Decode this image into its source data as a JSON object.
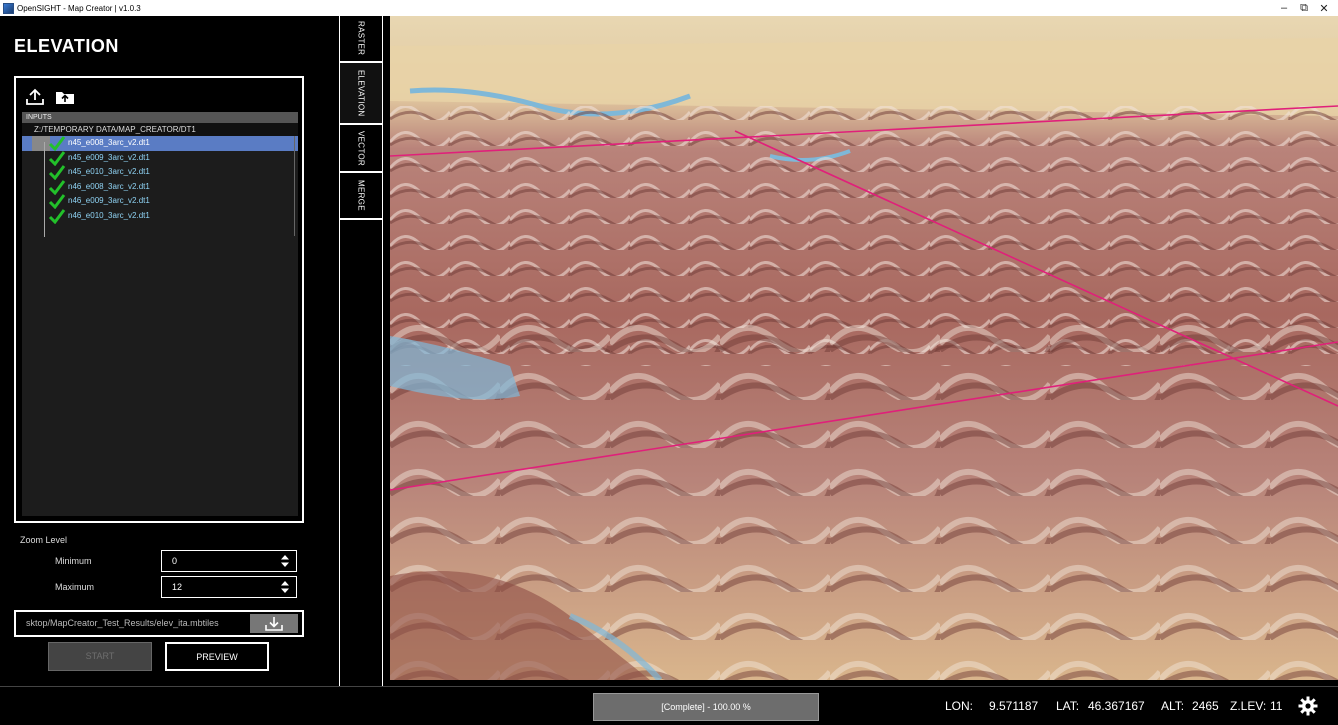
{
  "window": {
    "title": "OpenSIGHT - Map Creator | v1.0.3",
    "minimize": "–",
    "maximize": "⧉",
    "close": "✕"
  },
  "panel": {
    "title": "ELEVATION",
    "toolbar": {
      "upload_icon": "upload-icon",
      "folder_upload_icon": "folder-upload-icon"
    },
    "tree": {
      "header": "INPUTS",
      "root": "Z:/TEMPORARY DATA/MAP_CREATOR/DT1",
      "items": [
        {
          "label": "n45_e008_3arc_v2.dt1",
          "selected": true,
          "checked": true
        },
        {
          "label": "n45_e009_3arc_v2.dt1",
          "selected": false,
          "checked": true
        },
        {
          "label": "n45_e010_3arc_v2.dt1",
          "selected": false,
          "checked": true
        },
        {
          "label": "n46_e008_3arc_v2.dt1",
          "selected": false,
          "checked": true
        },
        {
          "label": "n46_e009_3arc_v2.dt1",
          "selected": false,
          "checked": true
        },
        {
          "label": "n46_e010_3arc_v2.dt1",
          "selected": false,
          "checked": true
        }
      ]
    },
    "zoom": {
      "label": "Zoom Level",
      "min_label": "Minimum",
      "min_value": "0",
      "max_label": "Maximum",
      "max_value": "12"
    },
    "output_path": "sktop/MapCreator_Test_Results/elev_ita.mbtiles",
    "start_label": "START",
    "preview_label": "PREVIEW"
  },
  "tabs": [
    "RASTER",
    "ELEVATION",
    "VECTOR",
    "MERGE"
  ],
  "status": {
    "progress_text": "[Complete] - 100.00 %",
    "progress_fraction": 1.0,
    "lon_label": "LON:",
    "lon": "9.571187",
    "lat_label": "LAT:",
    "lat": "46.367167",
    "alt_label": "ALT:",
    "alt": "2465",
    "zlev_label": "Z.LEV:",
    "zlev": "11"
  },
  "colors": {
    "accent_selected": "#5a7cc4",
    "check": "#22c02a",
    "grid_line": "#e0207a",
    "terrain_high": "#9c5a55",
    "terrain_low": "#e6cfa0",
    "water": "#7fb8d8"
  }
}
